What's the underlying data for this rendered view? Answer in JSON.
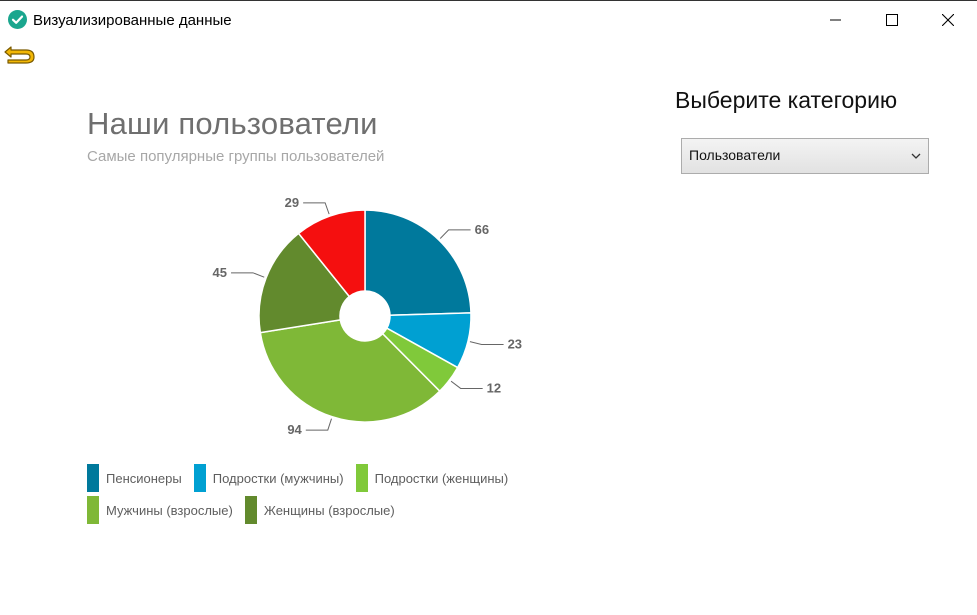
{
  "window": {
    "title": "Визуализированные данные",
    "controls": {
      "minimize": "minimize-icon",
      "maximize": "maximize-icon",
      "close": "close-icon"
    }
  },
  "toolbar": {
    "back_icon": "back-arrow-icon"
  },
  "sidebar": {
    "category_title": "Выберите категорию",
    "category_select": {
      "selected": "Пользователи"
    }
  },
  "chart_data": {
    "type": "pie",
    "style": "donut",
    "title": "Наши пользователи",
    "subtitle": "Самые популярные группы пользователей",
    "categories": [
      "Пенсионеры",
      "Подростки (мужчины)",
      "Подростки (женщины)",
      "Мужчины (взрослые)",
      "Женщины (взрослые)",
      ""
    ],
    "values": [
      66,
      23,
      12,
      94,
      45,
      29
    ],
    "colors": [
      "#00799c",
      "#00a0d2",
      "#80c93a",
      "#7fb837",
      "#628a2d",
      "#f50f0f"
    ],
    "legend_placement": "bottom-left"
  }
}
